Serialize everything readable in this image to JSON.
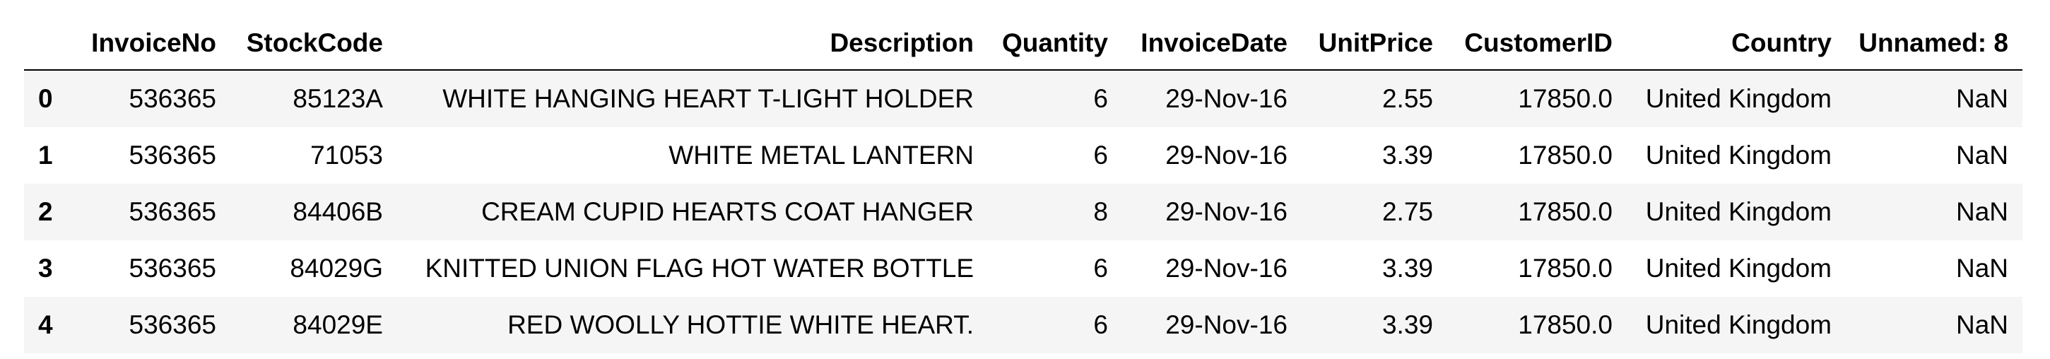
{
  "table": {
    "columns": [
      "",
      "InvoiceNo",
      "StockCode",
      "Description",
      "Quantity",
      "InvoiceDate",
      "UnitPrice",
      "CustomerID",
      "Country",
      "Unnamed: 8"
    ],
    "rows": [
      [
        "0",
        "536365",
        "85123A",
        "WHITE HANGING HEART T-LIGHT HOLDER",
        "6",
        "29-Nov-16",
        "2.55",
        "17850.0",
        "United Kingdom",
        "NaN"
      ],
      [
        "1",
        "536365",
        "71053",
        "WHITE METAL LANTERN",
        "6",
        "29-Nov-16",
        "3.39",
        "17850.0",
        "United Kingdom",
        "NaN"
      ],
      [
        "2",
        "536365",
        "84406B",
        "CREAM CUPID HEARTS COAT HANGER",
        "8",
        "29-Nov-16",
        "2.75",
        "17850.0",
        "United Kingdom",
        "NaN"
      ],
      [
        "3",
        "536365",
        "84029G",
        "KNITTED UNION FLAG HOT WATER BOTTLE",
        "6",
        "29-Nov-16",
        "3.39",
        "17850.0",
        "United Kingdom",
        "NaN"
      ],
      [
        "4",
        "536365",
        "84029E",
        "RED WOOLLY HOTTIE WHITE HEART.",
        "6",
        "29-Nov-16",
        "3.39",
        "17850.0",
        "United Kingdom",
        "NaN"
      ]
    ]
  }
}
